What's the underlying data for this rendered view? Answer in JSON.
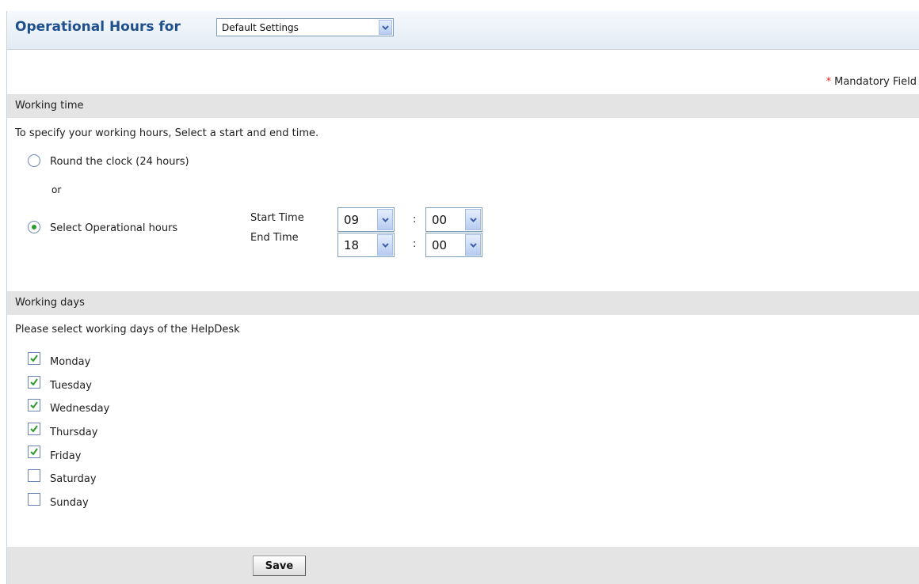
{
  "header": {
    "title": "Operational Hours for",
    "settings_select": "Default Settings"
  },
  "mandatory_note": "Mandatory Field",
  "working_time": {
    "section_title": "Working time",
    "instruction": "To specify your working hours, Select a start and end time.",
    "option_round_clock": "Round the clock (24 hours)",
    "or_text": "or",
    "option_operational": "Select Operational hours",
    "selected_option": "operational",
    "start_label": "Start Time",
    "end_label": "End Time",
    "start_hour": "09",
    "start_minute": "00",
    "end_hour": "18",
    "end_minute": "00",
    "separator": ":"
  },
  "working_days": {
    "section_title": "Working days",
    "instruction": "Please select working days of the HelpDesk",
    "days": [
      {
        "label": "Monday",
        "checked": true
      },
      {
        "label": "Tuesday",
        "checked": true
      },
      {
        "label": "Wednesday",
        "checked": true
      },
      {
        "label": "Thursday",
        "checked": true
      },
      {
        "label": "Friday",
        "checked": true
      },
      {
        "label": "Saturday",
        "checked": false
      },
      {
        "label": "Sunday",
        "checked": false
      }
    ]
  },
  "footer": {
    "save_label": "Save"
  },
  "colors": {
    "title": "#1f4f8c",
    "section_bar": "#e4e4e4",
    "mandatory_star": "#ee2222",
    "check": "#2e9a2e"
  }
}
